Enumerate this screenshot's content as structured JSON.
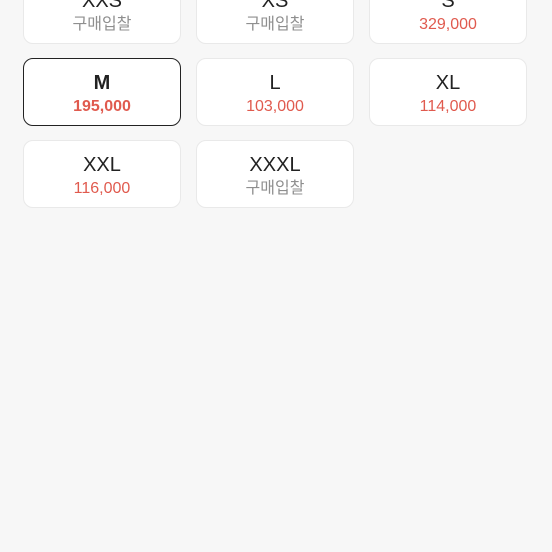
{
  "size_options": [
    {
      "size": "XXS",
      "price": "구매입찰",
      "is_bid": true,
      "selected": false
    },
    {
      "size": "XS",
      "price": "구매입찰",
      "is_bid": true,
      "selected": false
    },
    {
      "size": "S",
      "price": "329,000",
      "is_bid": false,
      "selected": false
    },
    {
      "size": "M",
      "price": "195,000",
      "is_bid": false,
      "selected": true
    },
    {
      "size": "L",
      "price": "103,000",
      "is_bid": false,
      "selected": false
    },
    {
      "size": "XL",
      "price": "114,000",
      "is_bid": false,
      "selected": false
    },
    {
      "size": "XXL",
      "price": "116,000",
      "is_bid": false,
      "selected": false
    },
    {
      "size": "XXXL",
      "price": "구매입찰",
      "is_bid": true,
      "selected": false
    }
  ],
  "colors": {
    "price": "#e05a4e",
    "bid_text": "#8f8f8f",
    "selected_border": "#222222",
    "card_border": "#e9e9e9",
    "background": "#f7f7f7"
  }
}
